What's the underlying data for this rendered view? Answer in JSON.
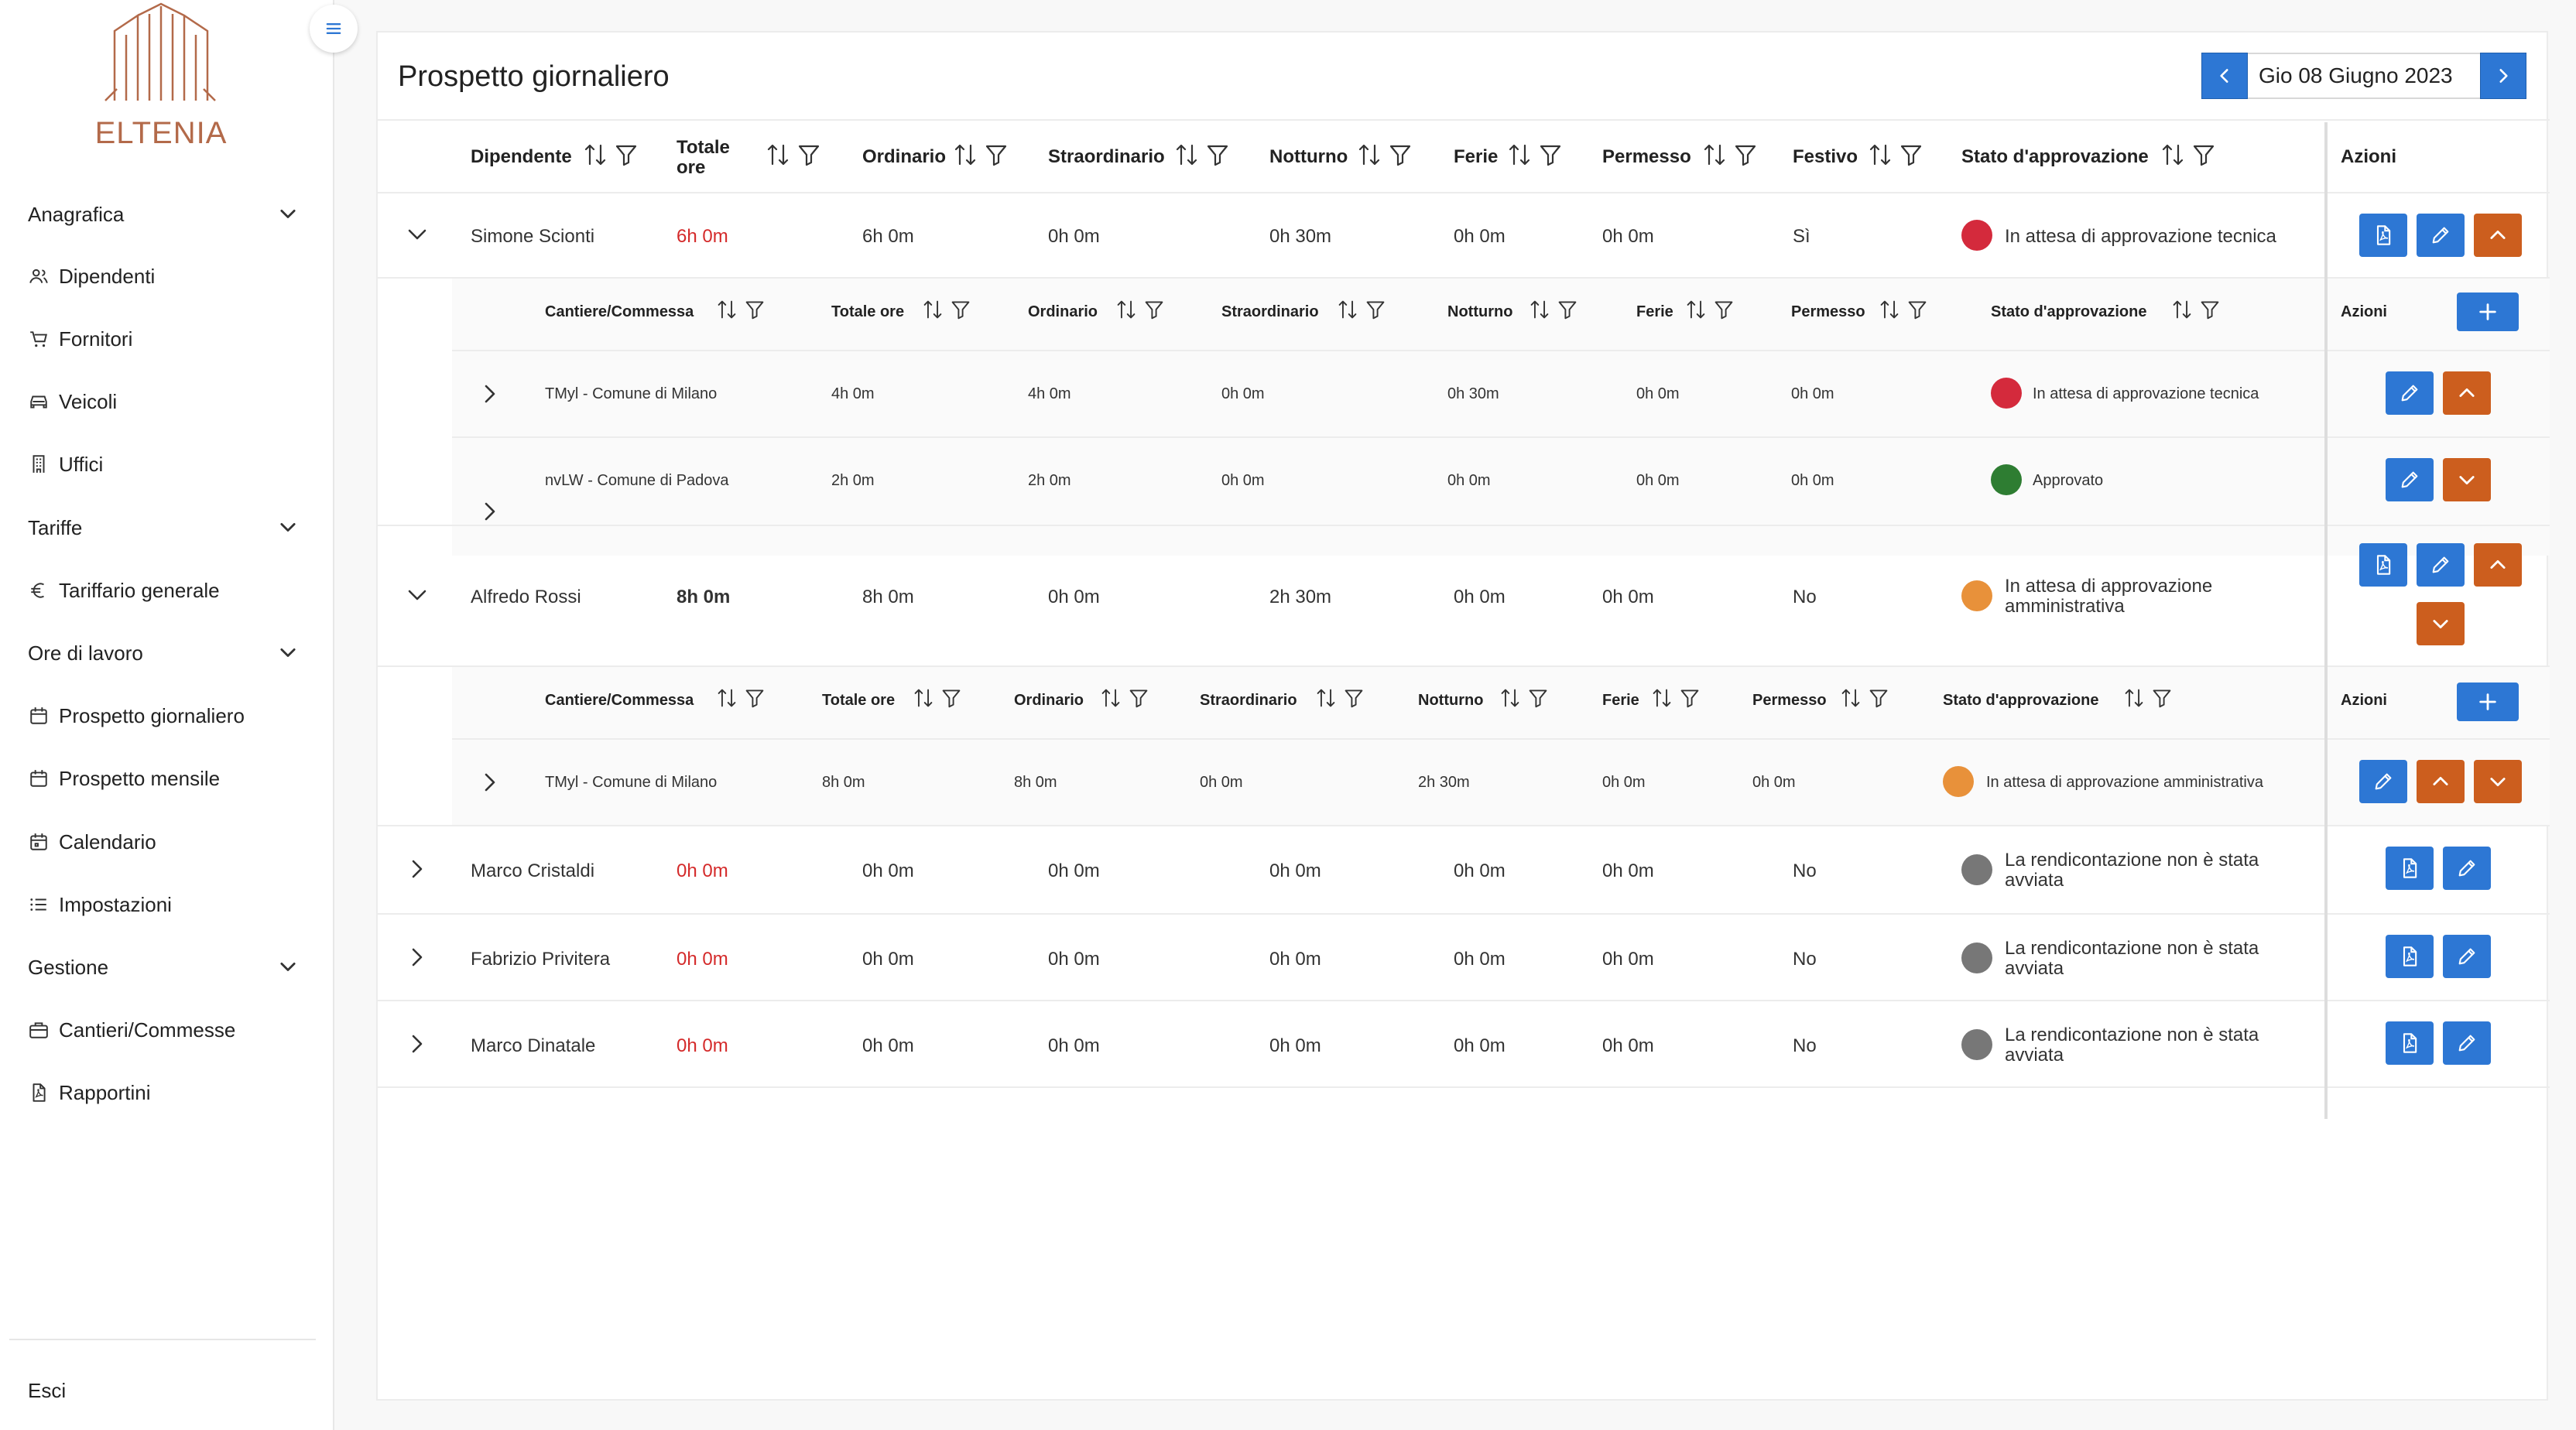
{
  "brand": {
    "logo_text": "ELTENIA",
    "accent": "#b36a4a"
  },
  "sidebar": {
    "groups": [
      {
        "label": "Anagrafica",
        "items": [
          {
            "label": "Dipendenti",
            "icon": "users-icon"
          },
          {
            "label": "Fornitori",
            "icon": "cart-icon"
          },
          {
            "label": "Veicoli",
            "icon": "car-icon"
          },
          {
            "label": "Uffici",
            "icon": "building-icon"
          }
        ]
      },
      {
        "label": "Tariffe",
        "items": [
          {
            "label": "Tariffario generale",
            "icon": "euro-icon"
          }
        ]
      },
      {
        "label": "Ore di lavoro",
        "items": [
          {
            "label": "Prospetto giornaliero",
            "icon": "calendar-icon"
          },
          {
            "label": "Prospetto mensile",
            "icon": "calendar-icon"
          },
          {
            "label": "Calendario",
            "icon": "calendar-icon"
          },
          {
            "label": "Impostazioni",
            "icon": "list-icon"
          }
        ]
      },
      {
        "label": "Gestione",
        "items": [
          {
            "label": "Cantieri/Commesse",
            "icon": "briefcase-icon"
          },
          {
            "label": "Rapportini",
            "icon": "file-icon"
          }
        ]
      }
    ],
    "logout": "Esci"
  },
  "page": {
    "title": "Prospetto giornaliero",
    "date": "Gio 08 Giugno 2023"
  },
  "table": {
    "headers": {
      "dipendente": "Dipendente",
      "totale_1": "Totale",
      "totale_2": "ore",
      "ordinario": "Ordinario",
      "straordinario": "Straordinario",
      "notturno": "Notturno",
      "ferie": "Ferie",
      "permesso": "Permesso",
      "festivo": "Festivo",
      "stato": "Stato d'approvazione",
      "azioni": "Azioni"
    },
    "sub_headers": {
      "cantiere": "Cantiere/Commessa",
      "totale": "Totale ore",
      "ordinario": "Ordinario",
      "straordinario": "Straordinario",
      "notturno": "Notturno",
      "ferie": "Ferie",
      "permesso": "Permesso",
      "stato": "Stato d'approvazione",
      "azioni": "Azioni"
    },
    "rows": [
      {
        "name": "Simone Scionti",
        "totale": "6h 0m",
        "ordinario": "6h 0m",
        "straordinario": "0h 0m",
        "notturno": "0h 30m",
        "ferie": "0h 0m",
        "permesso": "0h 0m",
        "festivo": "Sì",
        "stato": "In attesa di approvazione tecnica",
        "stato_color": "#d42a3c",
        "sub": [
          {
            "cantiere": "TMyl - Comune di Milano",
            "totale": "4h 0m",
            "ordinario": "4h 0m",
            "straordinario": "0h 0m",
            "notturno": "0h 30m",
            "ferie": "0h 0m",
            "permesso": "0h 0m",
            "stato": "In attesa di approvazione tecnica",
            "stato_color": "#d42a3c"
          },
          {
            "cantiere": "nvLW - Comune di Padova",
            "totale": "2h 0m",
            "ordinario": "2h 0m",
            "straordinario": "0h 0m",
            "notturno": "0h 0m",
            "ferie": "0h 0m",
            "permesso": "0h 0m",
            "stato": "Approvato",
            "stato_color": "#2e7d32"
          }
        ]
      },
      {
        "name": "Alfredo Rossi",
        "totale": "8h 0m",
        "ordinario": "8h 0m",
        "straordinario": "0h 0m",
        "notturno": "2h 30m",
        "ferie": "0h 0m",
        "permesso": "0h 0m",
        "festivo": "No",
        "stato_1": "In attesa di approvazione",
        "stato_2": "amministrativa",
        "stato_color": "#e8913a",
        "sub": [
          {
            "cantiere": "TMyl - Comune di Milano",
            "totale": "8h 0m",
            "ordinario": "8h 0m",
            "straordinario": "0h 0m",
            "notturno": "2h 30m",
            "ferie": "0h 0m",
            "permesso": "0h 0m",
            "stato": "In attesa di approvazione amministrativa",
            "stato_color": "#e8913a"
          }
        ]
      },
      {
        "name": "Marco Cristaldi",
        "totale": "0h 0m",
        "ordinario": "0h 0m",
        "straordinario": "0h 0m",
        "notturno": "0h 0m",
        "ferie": "0h 0m",
        "permesso": "0h 0m",
        "festivo": "No",
        "stato_1": "La rendicontazione non è stata",
        "stato_2": "avviata",
        "stato_color": "#777777"
      },
      {
        "name": "Fabrizio Privitera",
        "totale": "0h 0m",
        "ordinario": "0h 0m",
        "straordinario": "0h 0m",
        "notturno": "0h 0m",
        "ferie": "0h 0m",
        "permesso": "0h 0m",
        "festivo": "No",
        "stato_1": "La rendicontazione non è stata",
        "stato_2": "avviata",
        "stato_color": "#777777"
      },
      {
        "name": "Marco Dinatale",
        "totale": "0h 0m",
        "ordinario": "0h 0m",
        "straordinario": "0h 0m",
        "notturno": "0h 0m",
        "ferie": "0h 0m",
        "permesso": "0h 0m",
        "festivo": "No",
        "stato_1": "La rendicontazione non è stata",
        "stato_2": "avviata",
        "stato_color": "#777777"
      }
    ]
  },
  "colors": {
    "primary": "#2d77d4",
    "warning": "#cc5e1e",
    "danger_text": "#d42a2a"
  }
}
